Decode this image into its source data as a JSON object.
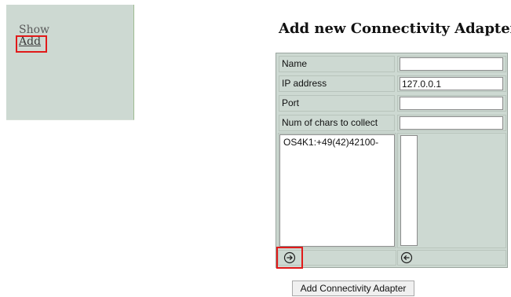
{
  "nav": {
    "show_label": "Show",
    "add_label": "Add"
  },
  "page": {
    "title": "Add new Connectivity Adapter"
  },
  "form": {
    "name_label": "Name",
    "name_value": "",
    "ip_label": "IP address",
    "ip_value": "127.0.0.1",
    "port_label": "Port",
    "port_value": "",
    "chars_label": "Num of chars to collect",
    "chars_value": ""
  },
  "lists": {
    "available_items": [
      "OS4K1:+49(42)42100-"
    ],
    "selected_items": []
  },
  "buttons": {
    "move_right_icon": "circle-arrow-right-icon",
    "move_left_icon": "circle-arrow-left-icon",
    "submit_label": "Add Connectivity Adapter"
  },
  "highlight_color": "#e11a1a"
}
